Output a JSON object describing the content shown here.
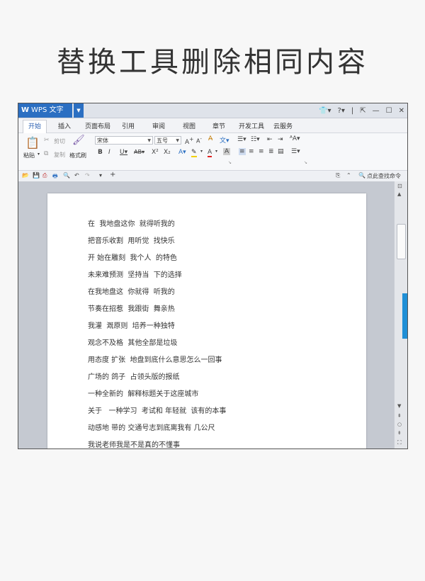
{
  "hero_title": "替换工具删除相同内容",
  "app": {
    "name": "WPS 文字",
    "logo_letter": "W"
  },
  "menu_tabs": [
    "开始",
    "插入",
    "页面布局",
    "引用",
    "审阅",
    "视图",
    "章节",
    "开发工具",
    "云服务"
  ],
  "ribbon": {
    "paste": "粘贴",
    "cut": "剪切",
    "copy": "复制",
    "format_painter": "格式刷",
    "font_name": "宋体",
    "font_size": "五号"
  },
  "quickbar": {
    "find_command": "点此查找命令"
  },
  "document_lines": [
    "在  我地盘这你  就得听我的",
    "把音乐收割  用听觉  找快乐",
    "开 始在雕刻  我个人  的特色",
    "未来难预测  坚持当  下的选择",
    "在我地盘这  你就得  听我的",
    "节奏在招惹  我跟街  舞亲热",
    "我灌  溉原则  培养一种独特",
    "观念不及格  其他全部是垃圾",
    "用态度 扩张  地盘到底什么意思怎么一回事",
    "广场的 鸽子  占领头版的报纸",
    "一种全新的  解释标题关于这座城市",
    "关于   一种学习  考试和 年轻就  该有的本事",
    "动感地 带的 交通号志到底离我有 几公尺",
    "我说老师我是不是真的不懂事"
  ],
  "colors": {
    "accent": "#2b6fc2",
    "doc_background": "#c5c9d1",
    "scroll_tab": "#1f8fd6"
  }
}
